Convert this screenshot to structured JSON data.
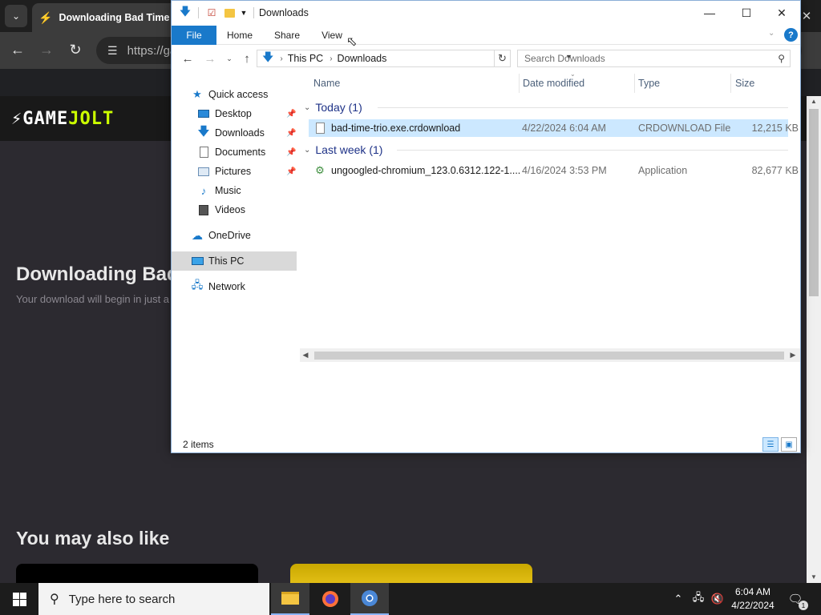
{
  "browser": {
    "tab_title": "Downloading Bad Time Tr",
    "url_text": "https://ga",
    "logo_game": "GAME",
    "logo_jolt": "JOLT",
    "page_title": "Downloading Bad",
    "page_subtitle": "Your download will begin in just a",
    "section_title": "You may also like"
  },
  "explorer": {
    "title": "Downloads",
    "ribbon_tabs": [
      "File",
      "Home",
      "Share",
      "View"
    ],
    "address": {
      "root": "This PC",
      "current": "Downloads"
    },
    "search_placeholder": "Search Downloads",
    "nav": {
      "quick_access": "Quick access",
      "desktop": "Desktop",
      "downloads": "Downloads",
      "documents": "Documents",
      "pictures": "Pictures",
      "music": "Music",
      "videos": "Videos",
      "onedrive": "OneDrive",
      "this_pc": "This PC",
      "network": "Network"
    },
    "columns": {
      "name": "Name",
      "date": "Date modified",
      "type": "Type",
      "size": "Size"
    },
    "groups": [
      {
        "label": "Today (1)",
        "files": [
          {
            "name": "bad-time-trio.exe.crdownload",
            "date": "4/22/2024 6:04 AM",
            "type": "CRDOWNLOAD File",
            "size": "12,215 KB"
          }
        ]
      },
      {
        "label": "Last week (1)",
        "files": [
          {
            "name": "ungoogled-chromium_123.0.6312.122-1....",
            "date": "4/16/2024 3:53 PM",
            "type": "Application",
            "size": "82,677 KB"
          }
        ]
      }
    ],
    "status": "2 items"
  },
  "taskbar": {
    "search_placeholder": "Type here to search",
    "time": "6:04 AM",
    "date": "4/22/2024",
    "notification_count": "1"
  },
  "icons": {
    "folder_color": "#f4c542",
    "accent": "#1979ca"
  }
}
